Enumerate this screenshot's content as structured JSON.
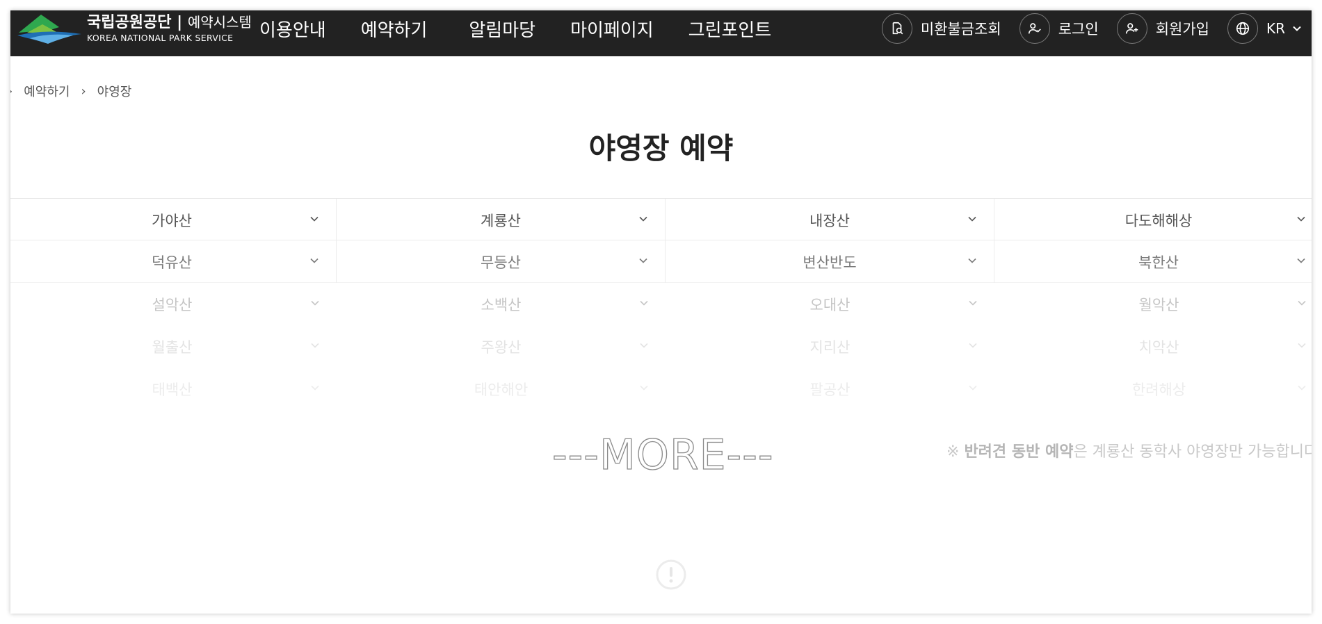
{
  "header": {
    "logo": {
      "name": "국립공원공단",
      "sub": "예약시스템",
      "en": "KOREA NATIONAL PARK SERVICE"
    },
    "menu": [
      "이용안내",
      "예약하기",
      "알림마당",
      "마이페이지",
      "그린포인트"
    ],
    "util": {
      "unpaid": "미환불금조회",
      "login": "로그인",
      "signup": "회원가입",
      "lang": "KR"
    }
  },
  "breadcrumb": {
    "items": [
      "예약하기",
      "야영장"
    ]
  },
  "page_title": "야영장 예약",
  "parks": [
    [
      "가야산",
      "계룡산",
      "내장산",
      "다도해해상"
    ],
    [
      "덕유산",
      "무등산",
      "변산반도",
      "북한산"
    ],
    [
      "설악산",
      "소백산",
      "오대산",
      "월악산"
    ],
    [
      "월출산",
      "주왕산",
      "지리산",
      "치악산"
    ],
    [
      "태백산",
      "태안해안",
      "팔공산",
      "한려해상"
    ]
  ],
  "more_label": "---MORE---",
  "notice": {
    "prefix": "※",
    "bold": "반려견 동반 예약",
    "rest": "은 계룡산 동학사 야영장만 가능합니다"
  },
  "colors": {
    "header_bg": "#222222",
    "accent_green": "#2fa84f",
    "accent_blue": "#1f6fb5"
  },
  "icons": {
    "unpaid": "document-search-icon",
    "login": "user-check-icon",
    "signup": "user-plus-icon",
    "lang": "globe-icon",
    "alert": "exclamation-circle-icon"
  }
}
